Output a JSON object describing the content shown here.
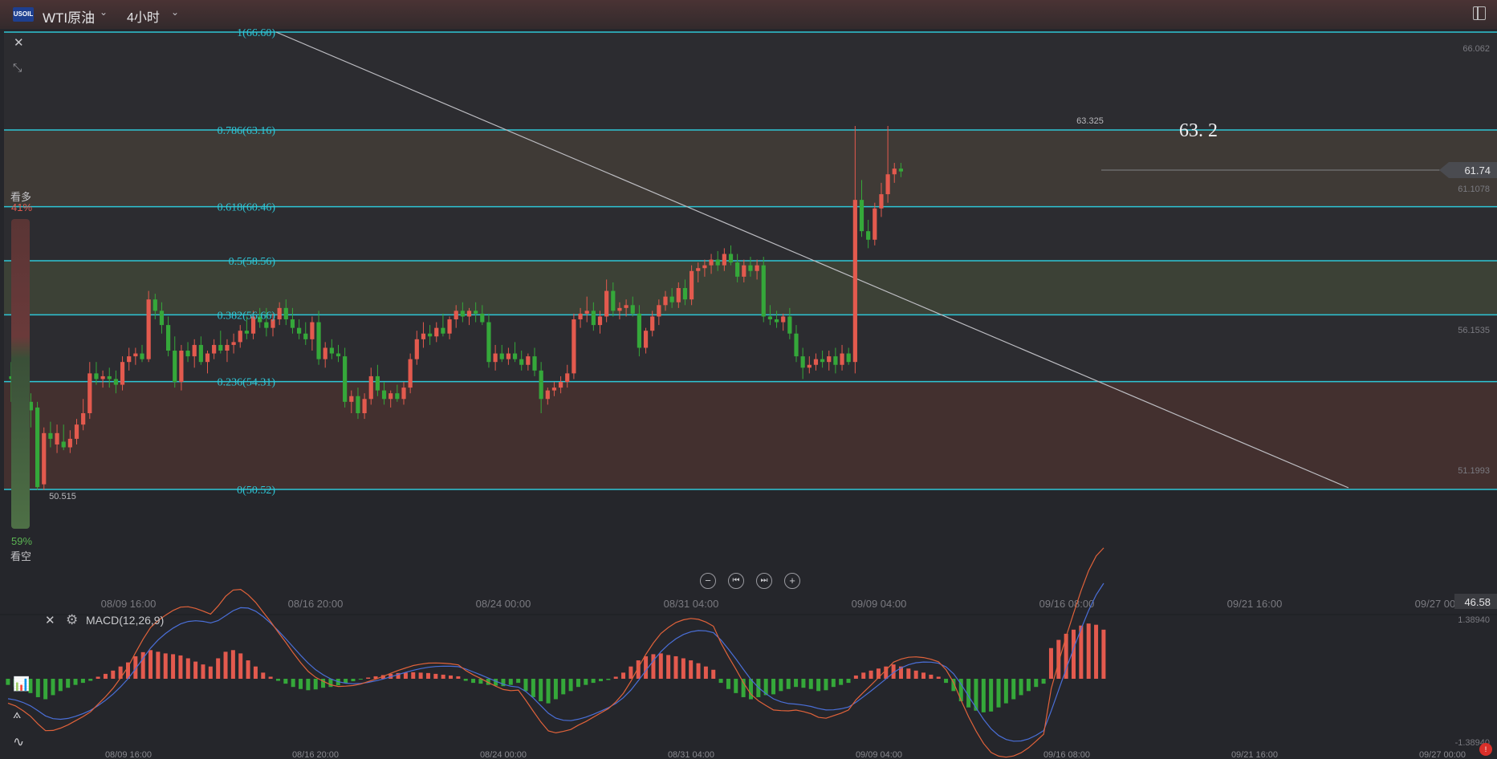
{
  "header": {
    "symbol_badge": "USOIL",
    "symbol_name": "WTI原油",
    "period": "4小时"
  },
  "sentiment": {
    "top_label": "看多",
    "top_pct": "41%",
    "bottom_pct": "59%",
    "bottom_label": "看空",
    "bullish_fraction": 0.41
  },
  "fibonacci": [
    {
      "label": "1(66.60)",
      "price": 66.6
    },
    {
      "label": "0.786(63.16)",
      "price": 63.16
    },
    {
      "label": "0.618(60.46)",
      "price": 60.46
    },
    {
      "label": "0.5(58.56)",
      "price": 58.56
    },
    {
      "label": "0.382(56.66)",
      "price": 56.66
    },
    {
      "label": "0.236(54.31)",
      "price": 54.31
    },
    {
      "label": "0(50.52)",
      "price": 50.52
    }
  ],
  "price_axis": [
    "66.062",
    "61.1078",
    "56.1535",
    "51.1993"
  ],
  "current_price": "61.74",
  "high_label": "63.325",
  "low_label": "50.515",
  "annotation": "63. 2",
  "time_axis": [
    "08/09 16:00",
    "08/16 20:00",
    "08/24 00:00",
    "08/31 04:00",
    "09/09 04:00",
    "09/16 08:00",
    "09/21 16:00",
    "09/27 00:00"
  ],
  "macd": {
    "title": "MACD(12,26,9)",
    "axis_top_value": "46.58",
    "axis_max": "1.38940",
    "axis_min": "-1.38940"
  },
  "colors": {
    "up": "#e35a4e",
    "down": "#35a83a",
    "fib_line": "#2ec6d6",
    "dif_line": "#e0623a",
    "dea_line": "#4a6fd8"
  },
  "chart_data": {
    "type": "candlestick",
    "candles": [
      [
        54.5,
        55.0,
        53.6,
        54.4
      ],
      [
        54.4,
        55.2,
        53.9,
        54.1
      ],
      [
        54.1,
        54.3,
        53.2,
        53.6
      ],
      [
        53.6,
        53.9,
        52.7,
        53.3
      ],
      [
        53.4,
        53.6,
        50.5,
        50.6
      ],
      [
        50.7,
        52.7,
        50.5,
        52.5
      ],
      [
        52.5,
        52.9,
        52.0,
        52.3
      ],
      [
        52.1,
        52.8,
        51.8,
        52.5
      ],
      [
        52.2,
        52.8,
        51.9,
        52.0
      ],
      [
        52.0,
        52.6,
        51.8,
        52.3
      ],
      [
        52.3,
        53.0,
        52.1,
        52.8
      ],
      [
        52.8,
        53.7,
        52.6,
        53.2
      ],
      [
        53.2,
        55.0,
        53.0,
        54.6
      ],
      [
        54.6,
        55.0,
        54.2,
        54.4
      ],
      [
        54.4,
        54.7,
        54.1,
        54.5
      ],
      [
        54.5,
        54.8,
        54.1,
        54.4
      ],
      [
        54.4,
        54.7,
        53.9,
        54.2
      ],
      [
        54.2,
        55.2,
        54.0,
        55.0
      ],
      [
        55.0,
        55.5,
        54.7,
        55.2
      ],
      [
        55.2,
        55.5,
        54.9,
        55.3
      ],
      [
        55.3,
        55.6,
        55.0,
        55.1
      ],
      [
        55.1,
        57.5,
        55.0,
        57.2
      ],
      [
        57.2,
        57.4,
        56.5,
        56.8
      ],
      [
        56.8,
        57.1,
        56.0,
        56.3
      ],
      [
        56.3,
        56.6,
        55.2,
        55.4
      ],
      [
        55.4,
        55.9,
        54.1,
        54.3
      ],
      [
        54.3,
        55.6,
        54.0,
        55.4
      ],
      [
        55.4,
        55.7,
        55.0,
        55.2
      ],
      [
        55.2,
        55.8,
        54.8,
        55.6
      ],
      [
        55.6,
        55.9,
        54.9,
        55.0
      ],
      [
        55.0,
        55.4,
        54.6,
        55.3
      ],
      [
        55.3,
        55.8,
        55.1,
        55.6
      ],
      [
        55.6,
        56.1,
        55.3,
        55.4
      ],
      [
        55.4,
        55.8,
        55.0,
        55.6
      ],
      [
        55.6,
        56.0,
        55.3,
        55.7
      ],
      [
        55.7,
        56.3,
        55.5,
        56.1
      ],
      [
        56.1,
        56.6,
        55.8,
        56.0
      ],
      [
        56.0,
        56.8,
        55.8,
        56.6
      ],
      [
        56.6,
        56.9,
        56.2,
        56.4
      ],
      [
        56.4,
        56.9,
        55.9,
        56.2
      ],
      [
        56.2,
        56.7,
        55.9,
        56.5
      ],
      [
        56.5,
        57.1,
        56.3,
        56.9
      ],
      [
        56.9,
        57.2,
        56.3,
        56.5
      ],
      [
        56.5,
        56.9,
        56.0,
        56.2
      ],
      [
        56.2,
        56.5,
        55.8,
        56.0
      ],
      [
        56.0,
        56.4,
        55.6,
        55.8
      ],
      [
        55.8,
        56.6,
        55.4,
        56.4
      ],
      [
        56.4,
        56.8,
        54.9,
        55.1
      ],
      [
        55.1,
        55.7,
        54.8,
        55.5
      ],
      [
        55.5,
        55.8,
        55.1,
        55.3
      ],
      [
        55.3,
        55.6,
        55.0,
        55.2
      ],
      [
        55.2,
        55.5,
        53.4,
        53.6
      ],
      [
        53.6,
        54.0,
        53.2,
        53.8
      ],
      [
        53.8,
        54.1,
        53.0,
        53.2
      ],
      [
        53.2,
        53.9,
        53.0,
        53.7
      ],
      [
        53.7,
        54.8,
        53.5,
        54.5
      ],
      [
        54.5,
        54.9,
        53.8,
        54.0
      ],
      [
        54.0,
        54.3,
        53.5,
        53.7
      ],
      [
        53.7,
        54.0,
        53.4,
        53.9
      ],
      [
        53.9,
        54.2,
        53.6,
        53.7
      ],
      [
        53.7,
        54.3,
        53.5,
        54.1
      ],
      [
        54.1,
        55.3,
        53.9,
        55.1
      ],
      [
        55.1,
        56.1,
        54.9,
        55.8
      ],
      [
        55.8,
        56.4,
        55.5,
        56.0
      ],
      [
        56.0,
        56.3,
        55.6,
        55.9
      ],
      [
        55.9,
        56.4,
        55.7,
        56.2
      ],
      [
        56.2,
        56.7,
        55.9,
        56.0
      ],
      [
        56.0,
        56.6,
        55.8,
        56.5
      ],
      [
        56.5,
        57.0,
        56.2,
        56.8
      ],
      [
        56.8,
        57.1,
        56.4,
        56.6
      ],
      [
        56.6,
        56.9,
        56.3,
        56.8
      ],
      [
        56.8,
        57.1,
        56.4,
        56.7
      ],
      [
        56.7,
        57.0,
        56.3,
        56.4
      ],
      [
        56.4,
        56.7,
        54.8,
        55.0
      ],
      [
        55.0,
        55.6,
        54.7,
        55.3
      ],
      [
        55.3,
        55.6,
        55.0,
        55.1
      ],
      [
        55.1,
        55.5,
        54.9,
        55.3
      ],
      [
        55.3,
        55.7,
        55.0,
        55.1
      ],
      [
        55.1,
        55.4,
        54.7,
        54.9
      ],
      [
        54.9,
        55.3,
        54.7,
        55.2
      ],
      [
        55.2,
        55.5,
        54.5,
        54.7
      ],
      [
        54.7,
        55.0,
        53.2,
        53.7
      ],
      [
        53.7,
        54.1,
        53.5,
        54.0
      ],
      [
        54.0,
        54.3,
        53.8,
        54.1
      ],
      [
        54.1,
        54.5,
        53.9,
        54.3
      ],
      [
        54.3,
        54.9,
        54.1,
        54.6
      ],
      [
        54.6,
        56.7,
        54.4,
        56.5
      ],
      [
        56.5,
        56.9,
        56.2,
        56.7
      ],
      [
        56.7,
        57.3,
        56.4,
        56.8
      ],
      [
        56.8,
        57.1,
        56.1,
        56.3
      ],
      [
        56.3,
        56.8,
        56.0,
        56.6
      ],
      [
        56.6,
        57.9,
        56.4,
        57.5
      ],
      [
        57.5,
        57.8,
        56.6,
        56.8
      ],
      [
        56.8,
        57.1,
        56.5,
        56.9
      ],
      [
        56.9,
        57.2,
        56.6,
        57.0
      ],
      [
        57.0,
        57.3,
        56.6,
        56.7
      ],
      [
        56.7,
        57.0,
        55.2,
        55.5
      ],
      [
        55.5,
        56.2,
        55.3,
        56.1
      ],
      [
        56.1,
        56.8,
        55.9,
        56.6
      ],
      [
        56.6,
        57.2,
        56.3,
        57.0
      ],
      [
        57.0,
        57.5,
        56.8,
        57.3
      ],
      [
        57.3,
        57.6,
        56.9,
        57.1
      ],
      [
        57.1,
        57.8,
        56.9,
        57.6
      ],
      [
        57.6,
        57.9,
        57.0,
        57.2
      ],
      [
        57.2,
        58.4,
        57.0,
        58.2
      ],
      [
        58.2,
        58.5,
        57.8,
        58.3
      ],
      [
        58.3,
        58.6,
        58.0,
        58.4
      ],
      [
        58.4,
        58.8,
        58.1,
        58.6
      ],
      [
        58.6,
        58.9,
        58.2,
        58.4
      ],
      [
        58.4,
        59.0,
        58.2,
        58.8
      ],
      [
        58.8,
        59.1,
        58.4,
        58.5
      ],
      [
        58.5,
        58.8,
        57.8,
        58.0
      ],
      [
        58.0,
        58.6,
        57.8,
        58.4
      ],
      [
        58.4,
        58.7,
        58.0,
        58.2
      ],
      [
        58.2,
        58.6,
        57.9,
        58.4
      ],
      [
        58.4,
        58.7,
        56.4,
        56.6
      ],
      [
        56.6,
        57.0,
        56.3,
        56.5
      ],
      [
        56.5,
        56.8,
        56.2,
        56.4
      ],
      [
        56.4,
        56.7,
        56.1,
        56.6
      ],
      [
        56.6,
        56.9,
        55.8,
        56.0
      ],
      [
        56.0,
        56.3,
        55.0,
        55.2
      ],
      [
        55.2,
        55.5,
        54.4,
        54.8
      ],
      [
        54.8,
        55.2,
        54.6,
        54.9
      ],
      [
        54.9,
        55.3,
        54.7,
        55.1
      ],
      [
        55.1,
        55.4,
        54.8,
        55.0
      ],
      [
        55.0,
        55.4,
        54.7,
        55.2
      ],
      [
        55.2,
        55.5,
        54.6,
        54.9
      ],
      [
        54.9,
        55.6,
        54.7,
        55.3
      ],
      [
        55.3,
        55.5,
        54.9,
        55.0
      ],
      [
        55.0,
        63.3,
        54.6,
        60.7
      ],
      [
        60.7,
        61.4,
        59.4,
        59.6
      ],
      [
        59.6,
        60.0,
        59.0,
        59.3
      ],
      [
        59.3,
        60.6,
        59.1,
        60.4
      ],
      [
        60.4,
        61.3,
        60.1,
        60.9
      ],
      [
        60.9,
        63.3,
        60.6,
        61.6
      ],
      [
        61.6,
        62.0,
        61.3,
        61.8
      ],
      [
        61.8,
        62.0,
        61.5,
        61.7
      ]
    ],
    "macd_hist": [
      -0.15,
      -0.2,
      -0.28,
      -0.35,
      -0.45,
      -0.5,
      -0.4,
      -0.3,
      -0.22,
      -0.15,
      -0.1,
      -0.05,
      0.05,
      0.12,
      0.2,
      0.3,
      0.4,
      0.55,
      0.65,
      0.7,
      0.66,
      0.62,
      0.6,
      0.57,
      0.5,
      0.42,
      0.35,
      0.3,
      0.5,
      0.66,
      0.7,
      0.62,
      0.45,
      0.3,
      0.15,
      0.05,
      -0.05,
      -0.12,
      -0.2,
      -0.25,
      -0.28,
      -0.26,
      -0.22,
      -0.2,
      -0.16,
      -0.1,
      -0.06,
      -0.02,
      0.03,
      0.06,
      0.09,
      0.12,
      0.14,
      0.15,
      0.16,
      0.15,
      0.14,
      0.12,
      0.1,
      0.08,
      0.06,
      -0.05,
      -0.1,
      -0.12,
      -0.15,
      -0.17,
      -0.18,
      -0.15,
      -0.1,
      -0.3,
      -0.45,
      -0.55,
      -0.6,
      -0.5,
      -0.38,
      -0.3,
      -0.2,
      -0.15,
      -0.1,
      -0.06,
      -0.03,
      0.05,
      0.15,
      0.3,
      0.45,
      0.55,
      0.6,
      0.62,
      0.58,
      0.55,
      0.5,
      0.45,
      0.38,
      0.3,
      0.22,
      -0.1,
      -0.25,
      -0.35,
      -0.45,
      -0.5,
      -0.45,
      -0.4,
      -0.38,
      -0.3,
      -0.25,
      -0.2,
      -0.22,
      -0.25,
      -0.3,
      -0.28,
      -0.2,
      -0.15,
      -0.1,
      0.08,
      0.15,
      0.2,
      0.25,
      0.3,
      0.35,
      0.3,
      0.25,
      0.2,
      0.15,
      0.1,
      0.05,
      -0.1,
      -0.3,
      -0.55,
      -0.7,
      -0.78,
      -0.82,
      -0.8,
      -0.7,
      -0.6,
      -0.5,
      -0.4,
      -0.3,
      -0.2,
      -0.12,
      0.75,
      0.95,
      1.1,
      1.2,
      1.3,
      1.35,
      1.32,
      1.2
    ]
  }
}
